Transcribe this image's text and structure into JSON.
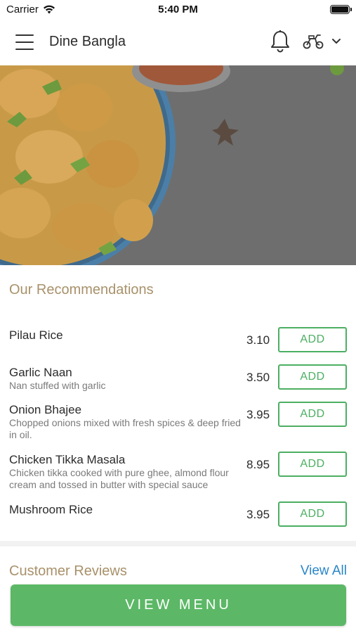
{
  "status_bar": {
    "carrier": "Carrier",
    "time": "5:40 PM"
  },
  "header": {
    "title": "Dine Bangla"
  },
  "recommendations": {
    "title": "Our Recommendations",
    "items": [
      {
        "name": "Pilau Rice",
        "description": "",
        "price": "3.10",
        "add_label": "ADD"
      },
      {
        "name": "Garlic Naan",
        "description": "Nan stuffed with garlic",
        "price": "3.50",
        "add_label": "ADD"
      },
      {
        "name": "Onion Bhajee",
        "description": "Chopped onions mixed with fresh spices & deep fried in oil.",
        "price": "3.95",
        "add_label": "ADD"
      },
      {
        "name": "Chicken Tikka Masala",
        "description": "Chicken tikka cooked with pure ghee, almond flour cream and tossed in butter with special sauce",
        "price": "8.95",
        "add_label": "ADD"
      },
      {
        "name": "Mushroom Rice",
        "description": "",
        "price": "3.95",
        "add_label": "ADD"
      }
    ]
  },
  "reviews": {
    "title": "Customer Reviews",
    "view_all_label": "View All"
  },
  "footer": {
    "view_menu_label": "VIEW MENU"
  },
  "colors": {
    "accent_green": "#5cb866",
    "section_title": "#a8916a",
    "link_blue": "#2a86c9"
  },
  "icons": [
    "wifi-icon",
    "battery-icon",
    "menu-icon",
    "bell-icon",
    "scooter-icon",
    "chevron-down-icon"
  ]
}
